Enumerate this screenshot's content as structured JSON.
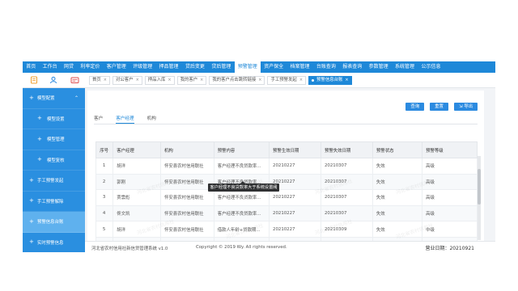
{
  "topnav": [
    "首页",
    "工作台",
    "网贷",
    "利率定价",
    "客户管理",
    "评级管理",
    "押品管理",
    "贷后变更",
    "贷后管理",
    "预警管理",
    "资产保全",
    "档案管理",
    "台账查询",
    "报表查询",
    "参数管理",
    "系统管理",
    "公示信息"
  ],
  "topnav_active": 9,
  "quick_icons": [
    "notebook-icon",
    "user-icon",
    "card-icon"
  ],
  "page_tabs": [
    {
      "label": "首页"
    },
    {
      "label": "对公客户"
    },
    {
      "label": "押品入库"
    },
    {
      "label": "我的客户"
    },
    {
      "label": "我的客户点击跳转链接"
    },
    {
      "label": "手工预警发起"
    },
    {
      "label": "预警信息台账",
      "active": true
    }
  ],
  "sidebar": [
    {
      "label": "模型配置",
      "level": 1,
      "expanded": true
    },
    {
      "label": "模型设置",
      "level": 2
    },
    {
      "label": "模型管理",
      "level": 2
    },
    {
      "label": "模型复核",
      "level": 2
    },
    {
      "label": "手工预警发起",
      "level": 1
    },
    {
      "label": "手工预警解除",
      "level": 1
    },
    {
      "label": "预警信息台账",
      "level": 1,
      "active": true
    },
    {
      "label": "实时预警信息",
      "level": 1
    },
    {
      "label": "预警信息推送",
      "level": 1
    }
  ],
  "buttons": {
    "query": "查询",
    "reset": "重置",
    "export": "导出"
  },
  "subtabs": [
    "客户",
    "客户经理",
    "机构"
  ],
  "subtab_active": 1,
  "table": {
    "columns": [
      "序号",
      "客户经理",
      "机构",
      "预警内容",
      "预警生效日期",
      "预警失效日期",
      "预警状态",
      "预警等级"
    ],
    "rows": [
      [
        "1",
        "胡洋",
        "怀安县农村信用联社",
        "客户经理不良贷款率...",
        "20210227",
        "20210307",
        "失效",
        "高级"
      ],
      [
        "2",
        "郭刚",
        "怀安县农村信用联社",
        "客户经理不良贷款率...",
        "20210227",
        "20210307",
        "失效",
        "高级"
      ],
      [
        "3",
        "贾雲彪",
        "怀安县农村信用联社",
        "客户经理不良贷款率...",
        "20210227",
        "20210307",
        "失效",
        "高级"
      ],
      [
        "4",
        "佟文凯",
        "怀安县农村信用联社",
        "客户经理不良贷款率...",
        "20210227",
        "20210307",
        "失效",
        "高级"
      ],
      [
        "5",
        "胡洋",
        "怀安县农村信用联社",
        "借款人年龄+贷款期...",
        "20210227",
        "20210309",
        "失效",
        "中级"
      ],
      [
        "6",
        "胡洋",
        "怀安县农村信用联社",
        "保证人年龄+贷款期...",
        "20210227",
        "20210309",
        "失效",
        "中级"
      ]
    ]
  },
  "tooltip": "客户经理不良贷款率大于系统设置阈值",
  "watermark": "河北省农村信用社",
  "footer": {
    "org": "河北省农村信用社新信贷管理系统 v1.0",
    "copyright": "Copyright © 2019 Wy. All rights reserved.",
    "date": "营业日期：20210921"
  },
  "colors": {
    "primary": "#1e88d8",
    "sidebar": "#2a8fe0",
    "sidebar_active": "#5fb1ee"
  }
}
